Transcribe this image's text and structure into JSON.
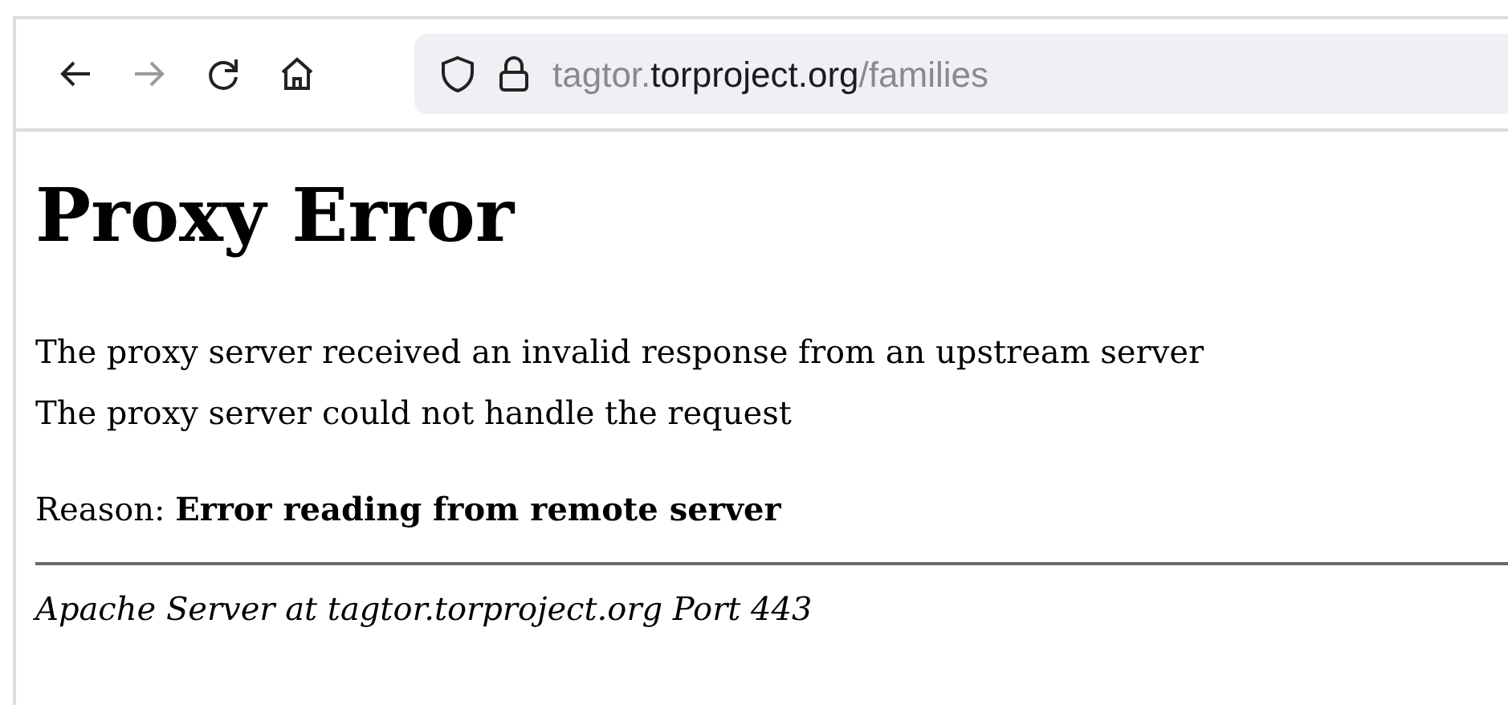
{
  "toolbar": {
    "back": {
      "disabled": false
    },
    "forward": {
      "disabled": true
    },
    "url": {
      "subdomain": "tagtor.",
      "domain": "torproject.org",
      "path": "/families"
    }
  },
  "page": {
    "heading": "Proxy Error",
    "paragraph_lines": [
      "The proxy server received an invalid response from an upstream server",
      "The proxy server could not handle the request"
    ],
    "reason": "Reason: **Error reading from remote server**",
    "address": "Apache Server at tagtor.torproject.org Port 443"
  }
}
